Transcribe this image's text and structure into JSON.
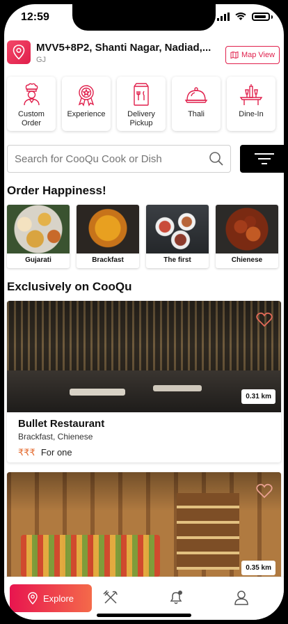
{
  "status_bar": {
    "time": "12:59"
  },
  "location": {
    "address": "MVV5+8P2, Shanti Nagar, Nadiad,...",
    "state": "GJ",
    "map_view_label": "Map View"
  },
  "categories": [
    {
      "label": "Custom\nOrder",
      "icon": "chef-icon"
    },
    {
      "label": "Experience",
      "icon": "badge-icon"
    },
    {
      "label": "Delivery\nPickup",
      "icon": "bag-icon"
    },
    {
      "label": "Thali",
      "icon": "cloche-icon"
    },
    {
      "label": "Dine-In",
      "icon": "dining-table-icon"
    }
  ],
  "search": {
    "placeholder": "Search for CooQu Cook or Dish"
  },
  "order_happiness": {
    "title": "Order Happiness!",
    "dishes": [
      "Gujarati",
      "Brackfast",
      "The first",
      "Chienese"
    ]
  },
  "exclusive": {
    "title": "Exclusively on CooQu",
    "restaurants": [
      {
        "name": "Bullet Restaurant",
        "cuisine": "Brackfast, Chienese",
        "price_symbol": "₹₹₹",
        "price_label": "For one",
        "distance": "0.31 km"
      },
      {
        "distance": "0.35 km"
      }
    ]
  },
  "tabbar": {
    "explore_label": "Explore"
  },
  "colors": {
    "accent": "#e01f4b",
    "filter_bg": "#000000"
  }
}
